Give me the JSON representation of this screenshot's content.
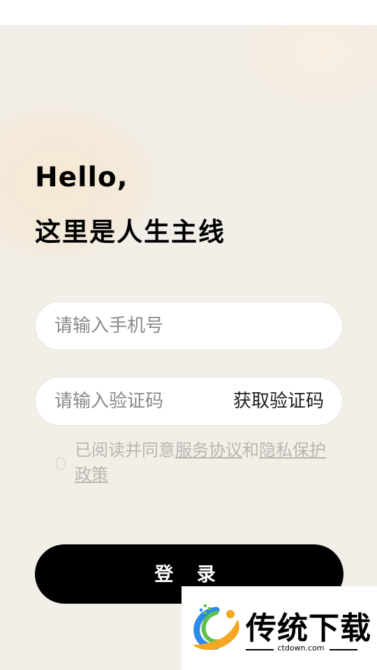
{
  "greeting": "Hello,",
  "slogan": "这里是人生主线",
  "phone": {
    "placeholder": "请输入手机号",
    "value": ""
  },
  "code": {
    "placeholder": "请输入验证码",
    "value": "",
    "get_code_label": "获取验证码"
  },
  "agreement": {
    "prefix": "已阅读并同意",
    "service_link": "服务协议",
    "and": "和",
    "privacy_link": "隐私保护政策",
    "checked": false
  },
  "login_label": "登 录",
  "watermark": {
    "title": "传统下载",
    "domain": "ctdown.com"
  },
  "colors": {
    "background": "#f2eee8",
    "button": "#000000",
    "input_background": "#ffffff",
    "placeholder": "#8a8a8a",
    "agreement_text": "#b9b5b0",
    "logo_orange": "#f5a623",
    "logo_blue": "#2b8be8",
    "logo_green": "#5fc14a"
  }
}
